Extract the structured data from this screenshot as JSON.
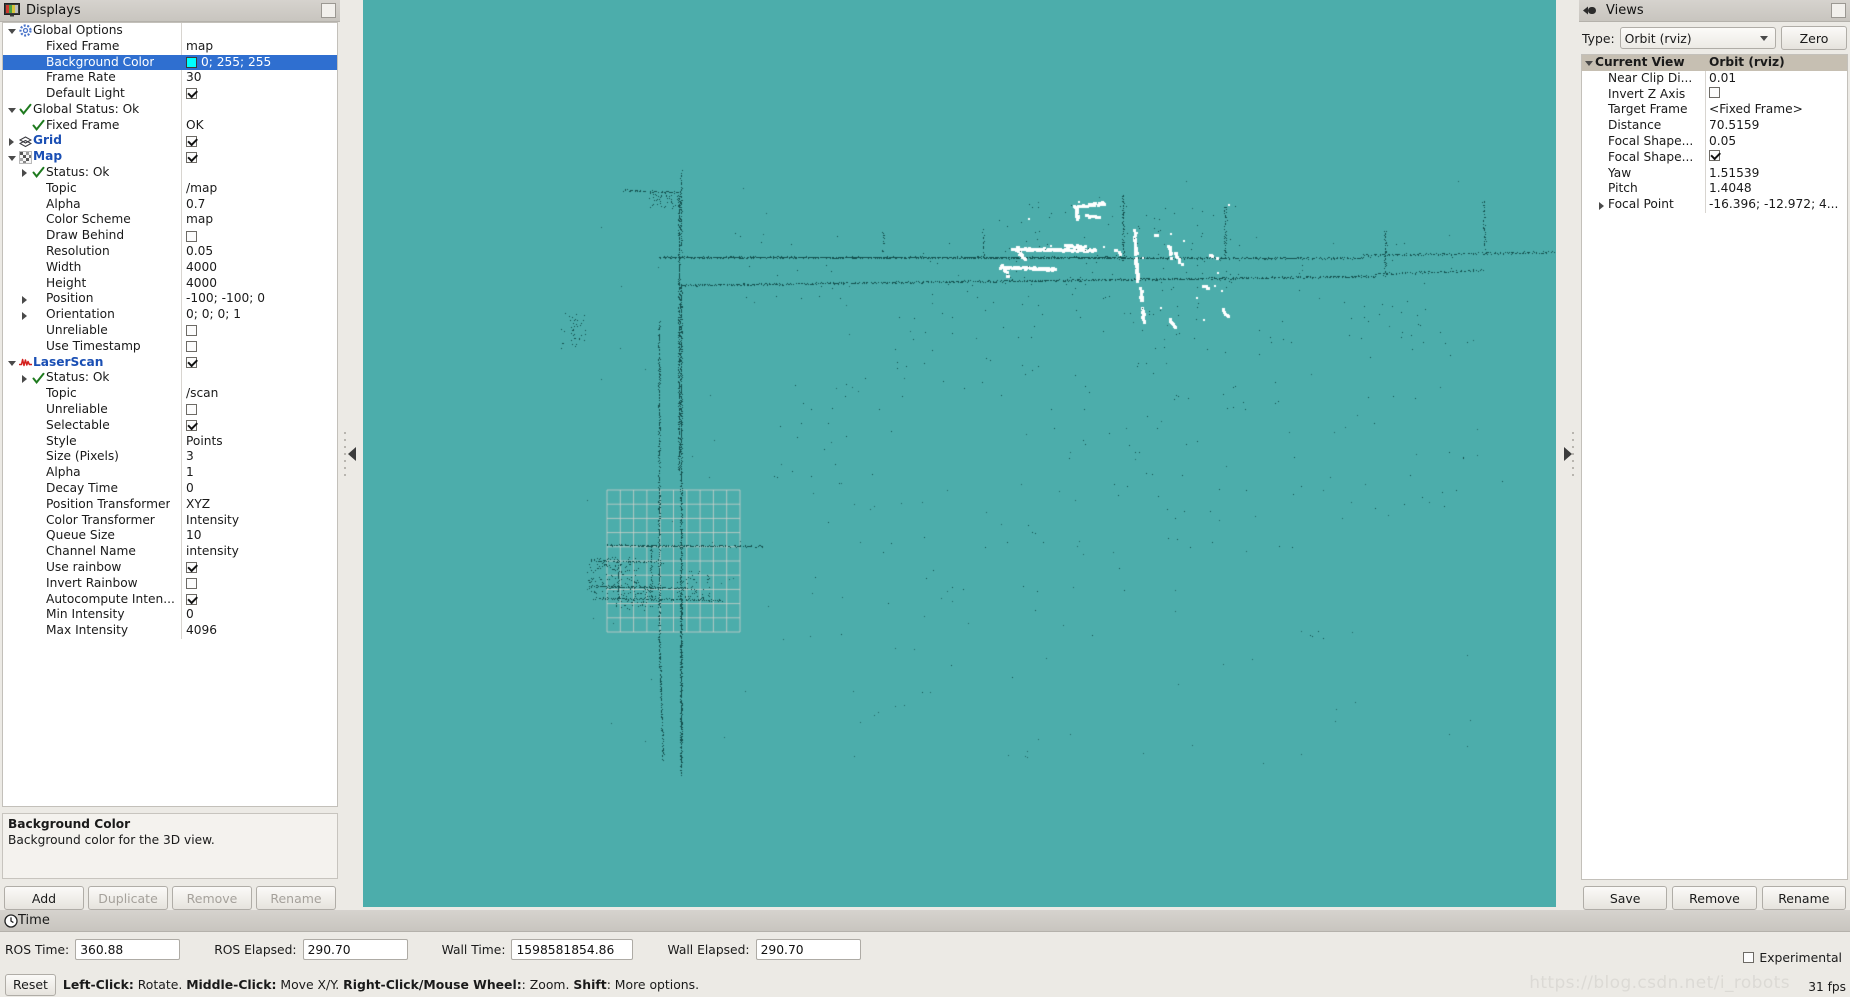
{
  "displays_panel": {
    "title": "Displays",
    "icon": "displays-icon",
    "description": {
      "title": "Background Color",
      "text": "Background color for the 3D view."
    },
    "buttons": [
      {
        "label": "Add",
        "enabled": true
      },
      {
        "label": "Duplicate",
        "enabled": false
      },
      {
        "label": "Remove",
        "enabled": false
      },
      {
        "label": "Rename",
        "enabled": false
      }
    ],
    "rows": [
      {
        "indent": 0,
        "arrow": "down",
        "icon": "gear-icon",
        "label": "Global Options",
        "bold": true,
        "value_type": "none",
        "value": ""
      },
      {
        "indent": 1,
        "arrow": "none",
        "icon": "none",
        "label": "Fixed Frame",
        "bold": false,
        "value_type": "text",
        "value": "map"
      },
      {
        "indent": 1,
        "arrow": "none",
        "icon": "none",
        "label": "Background Color",
        "bold": false,
        "value_type": "color",
        "value": "0; 255; 255",
        "color": "#00ffff",
        "selected": true
      },
      {
        "indent": 1,
        "arrow": "none",
        "icon": "none",
        "label": "Frame Rate",
        "bold": false,
        "value_type": "text",
        "value": "30"
      },
      {
        "indent": 1,
        "arrow": "none",
        "icon": "none",
        "label": "Default Light",
        "bold": false,
        "value_type": "check",
        "value": "checked"
      },
      {
        "indent": 0,
        "arrow": "down",
        "icon": "check-green-icon",
        "label": "Global Status: Ok",
        "bold": true,
        "value_type": "none",
        "value": ""
      },
      {
        "indent": 1,
        "arrow": "none",
        "icon": "check-green-icon",
        "label": "Fixed Frame",
        "bold": false,
        "value_type": "text",
        "value": "OK"
      },
      {
        "indent": 0,
        "arrow": "right",
        "icon": "grid-icon",
        "label": "Grid",
        "bold": true,
        "blue": true,
        "value_type": "check",
        "value": "checked"
      },
      {
        "indent": 0,
        "arrow": "down",
        "icon": "map-icon",
        "label": "Map",
        "bold": true,
        "blue": true,
        "value_type": "check",
        "value": "checked"
      },
      {
        "indent": 1,
        "arrow": "right",
        "icon": "check-green-icon",
        "label": "Status: Ok",
        "bold": false,
        "value_type": "none",
        "value": ""
      },
      {
        "indent": 1,
        "arrow": "none",
        "icon": "none",
        "label": "Topic",
        "bold": false,
        "value_type": "text",
        "value": "/map"
      },
      {
        "indent": 1,
        "arrow": "none",
        "icon": "none",
        "label": "Alpha",
        "bold": false,
        "value_type": "text",
        "value": "0.7"
      },
      {
        "indent": 1,
        "arrow": "none",
        "icon": "none",
        "label": "Color Scheme",
        "bold": false,
        "value_type": "text",
        "value": "map"
      },
      {
        "indent": 1,
        "arrow": "none",
        "icon": "none",
        "label": "Draw Behind",
        "bold": false,
        "value_type": "check",
        "value": "unchecked"
      },
      {
        "indent": 1,
        "arrow": "none",
        "icon": "none",
        "label": "Resolution",
        "bold": false,
        "value_type": "text",
        "value": "0.05"
      },
      {
        "indent": 1,
        "arrow": "none",
        "icon": "none",
        "label": "Width",
        "bold": false,
        "value_type": "text",
        "value": "4000"
      },
      {
        "indent": 1,
        "arrow": "none",
        "icon": "none",
        "label": "Height",
        "bold": false,
        "value_type": "text",
        "value": "4000"
      },
      {
        "indent": 1,
        "arrow": "right",
        "icon": "none",
        "label": "Position",
        "bold": false,
        "value_type": "text",
        "value": "-100; -100; 0"
      },
      {
        "indent": 1,
        "arrow": "right",
        "icon": "none",
        "label": "Orientation",
        "bold": false,
        "value_type": "text",
        "value": "0; 0; 0; 1"
      },
      {
        "indent": 1,
        "arrow": "none",
        "icon": "none",
        "label": "Unreliable",
        "bold": false,
        "value_type": "check",
        "value": "unchecked"
      },
      {
        "indent": 1,
        "arrow": "none",
        "icon": "none",
        "label": "Use Timestamp",
        "bold": false,
        "value_type": "check",
        "value": "unchecked"
      },
      {
        "indent": 0,
        "arrow": "down",
        "icon": "laserscan-icon",
        "label": "LaserScan",
        "bold": true,
        "blue": true,
        "value_type": "check",
        "value": "checked"
      },
      {
        "indent": 1,
        "arrow": "right",
        "icon": "check-green-icon",
        "label": "Status: Ok",
        "bold": false,
        "value_type": "none",
        "value": ""
      },
      {
        "indent": 1,
        "arrow": "none",
        "icon": "none",
        "label": "Topic",
        "bold": false,
        "value_type": "text",
        "value": "/scan"
      },
      {
        "indent": 1,
        "arrow": "none",
        "icon": "none",
        "label": "Unreliable",
        "bold": false,
        "value_type": "check",
        "value": "unchecked"
      },
      {
        "indent": 1,
        "arrow": "none",
        "icon": "none",
        "label": "Selectable",
        "bold": false,
        "value_type": "check",
        "value": "checked"
      },
      {
        "indent": 1,
        "arrow": "none",
        "icon": "none",
        "label": "Style",
        "bold": false,
        "value_type": "text",
        "value": "Points"
      },
      {
        "indent": 1,
        "arrow": "none",
        "icon": "none",
        "label": "Size (Pixels)",
        "bold": false,
        "value_type": "text",
        "value": "3"
      },
      {
        "indent": 1,
        "arrow": "none",
        "icon": "none",
        "label": "Alpha",
        "bold": false,
        "value_type": "text",
        "value": "1"
      },
      {
        "indent": 1,
        "arrow": "none",
        "icon": "none",
        "label": "Decay Time",
        "bold": false,
        "value_type": "text",
        "value": "0"
      },
      {
        "indent": 1,
        "arrow": "none",
        "icon": "none",
        "label": "Position Transformer",
        "bold": false,
        "value_type": "text",
        "value": "XYZ"
      },
      {
        "indent": 1,
        "arrow": "none",
        "icon": "none",
        "label": "Color Transformer",
        "bold": false,
        "value_type": "text",
        "value": "Intensity"
      },
      {
        "indent": 1,
        "arrow": "none",
        "icon": "none",
        "label": "Queue Size",
        "bold": false,
        "value_type": "text",
        "value": "10"
      },
      {
        "indent": 1,
        "arrow": "none",
        "icon": "none",
        "label": "Channel Name",
        "bold": false,
        "value_type": "text",
        "value": "intensity"
      },
      {
        "indent": 1,
        "arrow": "none",
        "icon": "none",
        "label": "Use rainbow",
        "bold": false,
        "value_type": "check",
        "value": "checked"
      },
      {
        "indent": 1,
        "arrow": "none",
        "icon": "none",
        "label": "Invert Rainbow",
        "bold": false,
        "value_type": "check",
        "value": "unchecked"
      },
      {
        "indent": 1,
        "arrow": "none",
        "icon": "none",
        "label": "Autocompute Inten...",
        "bold": false,
        "value_type": "check",
        "value": "checked"
      },
      {
        "indent": 1,
        "arrow": "none",
        "icon": "none",
        "label": "Min Intensity",
        "bold": false,
        "value_type": "text",
        "value": "0"
      },
      {
        "indent": 1,
        "arrow": "none",
        "icon": "none",
        "label": "Max Intensity",
        "bold": false,
        "value_type": "text",
        "value": "4096"
      }
    ]
  },
  "views_panel": {
    "title": "Views",
    "icon": "views-icon",
    "type_label": "Type:",
    "type_value": "Orbit (rviz)",
    "zero_button": "Zero",
    "header": {
      "name": "Current View",
      "value": "Orbit (rviz)"
    },
    "rows": [
      {
        "arrow": "none",
        "label": "Near Clip Di...",
        "value_type": "text",
        "value": "0.01"
      },
      {
        "arrow": "none",
        "label": "Invert Z Axis",
        "value_type": "check",
        "value": "unchecked"
      },
      {
        "arrow": "none",
        "label": "Target Frame",
        "value_type": "text",
        "value": "<Fixed Frame>"
      },
      {
        "arrow": "none",
        "label": "Distance",
        "value_type": "text",
        "value": "70.5159"
      },
      {
        "arrow": "none",
        "label": "Focal Shape...",
        "value_type": "text",
        "value": "0.05"
      },
      {
        "arrow": "none",
        "label": "Focal Shape...",
        "value_type": "check",
        "value": "checked"
      },
      {
        "arrow": "none",
        "label": "Yaw",
        "value_type": "text",
        "value": "1.51539"
      },
      {
        "arrow": "none",
        "label": "Pitch",
        "value_type": "text",
        "value": "1.4048"
      },
      {
        "arrow": "right",
        "label": "Focal Point",
        "value_type": "text",
        "value": "-16.396; -12.972; 4..."
      }
    ],
    "buttons": [
      {
        "label": "Save"
      },
      {
        "label": "Remove"
      },
      {
        "label": "Rename"
      }
    ]
  },
  "viewport": {
    "background_color": "#4cadab",
    "grid_color": "#d4d2cc",
    "map_point_color": "#14514f",
    "scan_point_color": "#ffffff"
  },
  "time_panel": {
    "title": "Time",
    "icon": "clock-icon",
    "fields": [
      {
        "label": "ROS Time:",
        "value": "360.88"
      },
      {
        "label": "ROS Elapsed:",
        "value": "290.70"
      },
      {
        "label": "Wall Time:",
        "value": "1598581854.86"
      },
      {
        "label": "Wall Elapsed:",
        "value": "290.70"
      }
    ],
    "experimental_label": "Experimental",
    "experimental_checked": false
  },
  "status_bar": {
    "reset_button": "Reset",
    "hint_parts": [
      {
        "text": "Left-Click:",
        "bold": true
      },
      {
        "text": " Rotate. ",
        "bold": false
      },
      {
        "text": "Middle-Click:",
        "bold": true
      },
      {
        "text": " Move X/Y. ",
        "bold": false
      },
      {
        "text": "Right-Click/Mouse Wheel:",
        "bold": true
      },
      {
        "text": ": Zoom. ",
        "bold": false
      },
      {
        "text": "Shift",
        "bold": true
      },
      {
        "text": ": More options.",
        "bold": false
      }
    ],
    "fps": "31 fps",
    "watermark": "https://blog.csdn.net/i_robots"
  }
}
